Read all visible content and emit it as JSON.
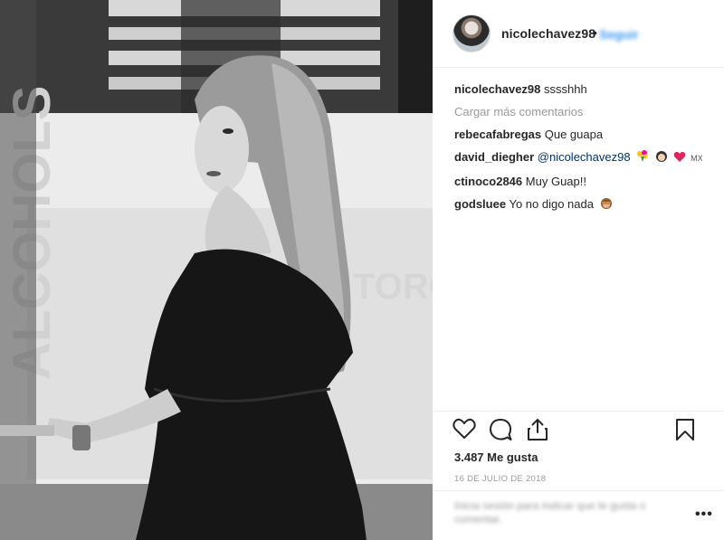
{
  "post": {
    "username": "nicolechavez98",
    "separator": "•",
    "follow_label": "Seguir",
    "caption_text": "sssshhh",
    "load_more": "Cargar más comentarios",
    "comments": [
      {
        "user": "rebecafabregas",
        "text": "Que guapa"
      },
      {
        "user": "david_diegher",
        "mention": "@nicolechavez98",
        "emoji_suffix": "MX"
      },
      {
        "user": "ctinoco2846",
        "text": "Muy Guap!!"
      },
      {
        "user": "godsluee",
        "text": "Yo no digo nada"
      }
    ],
    "likes": "3.487 Me gusta",
    "date": "16 DE JULIO DE 2018",
    "comment_placeholder": "Inicia sesión para indicar que te gusta o comentar.",
    "more_label": "•••"
  },
  "icons": {
    "like": "heart-icon",
    "comment": "comment-icon",
    "share": "share-icon",
    "save": "bookmark-icon",
    "accent": "#3897f0",
    "heart_emoji_color": "#e0245e"
  }
}
